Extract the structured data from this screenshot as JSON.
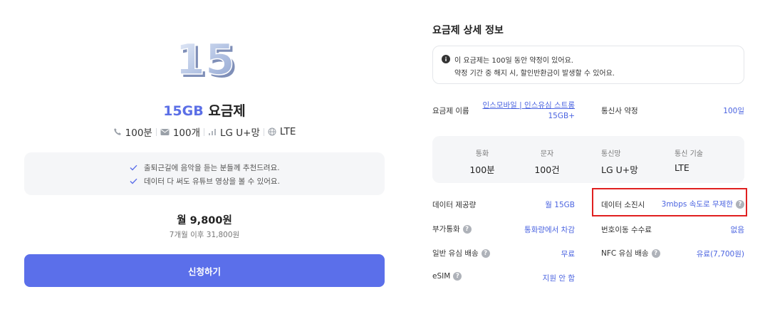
{
  "plan": {
    "badge_text": "15",
    "title_highlight": "15GB",
    "title_rest": "요금제",
    "specs": {
      "call": "100분",
      "message": "100개",
      "network": "LG U+망",
      "tech": "LTE"
    },
    "recommendations": [
      "출퇴근길에 음악을 듣는 분들께 추천드려요.",
      "데이터 다 써도 유튜브 영상을 볼 수 있어요."
    ],
    "price": "월 9,800원",
    "price_after": "7개월 이후 31,800원",
    "apply_label": "신청하기"
  },
  "details": {
    "section_title": "요금제 상세 정보",
    "notice_line1": "이 요금제는 100일 동안 약정이 있어요.",
    "notice_line2": "약정 기간 중 해지 시, 할인반환금이 발생할 수 있어요.",
    "plan_name_label": "요금제 이름",
    "plan_name_value_line1": "인스모바일 | 인스유심 스트롱",
    "plan_name_value_line2": "15GB+",
    "carrier_contract_label": "통신사 약정",
    "carrier_contract_value": "100일",
    "summary": [
      {
        "caption": "통화",
        "value": "100분"
      },
      {
        "caption": "문자",
        "value": "100건"
      },
      {
        "caption": "통신망",
        "value": "LG U+망"
      },
      {
        "caption": "통신 기술",
        "value": "LTE"
      }
    ],
    "data_provided_label": "데이터 제공량",
    "data_provided_value": "월 15GB",
    "data_exhausted_label": "데이터 소진시",
    "data_exhausted_value": "3mbps 속도로 무제한",
    "extra_call_label": "부가통화",
    "extra_call_value": "통화량에서 차감",
    "number_port_fee_label": "번호이동 수수료",
    "number_port_fee_value": "없음",
    "usim_delivery_label": "일반 유심 배송",
    "usim_delivery_value": "무료",
    "nfc_usim_delivery_label": "NFC 유심 배송",
    "nfc_usim_delivery_value": "유료(7,700원)",
    "esim_label": "eSIM",
    "esim_value": "지원 안 함"
  },
  "colors": {
    "accent": "#5b6fea",
    "link": "#4a63e0",
    "highlight_box": "#e02020",
    "panel_bg": "#f5f6f8"
  }
}
